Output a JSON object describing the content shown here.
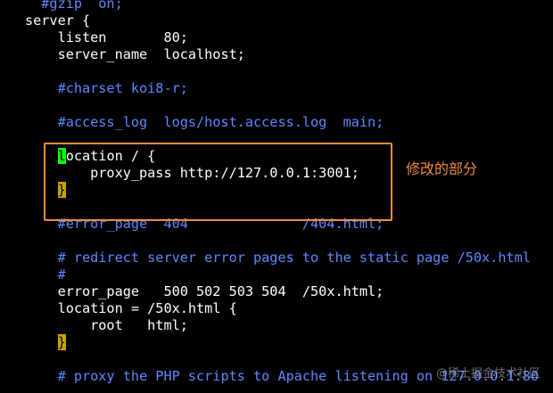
{
  "editor": {
    "lines": [
      {
        "text": "  #gzip  on;",
        "kind": "comment"
      },
      {
        "text": "server {",
        "kind": "code"
      },
      {
        "text": "    listen       80;",
        "kind": "code"
      },
      {
        "text": "    server_name  localhost;",
        "kind": "code"
      },
      {
        "text": "",
        "kind": "code"
      },
      {
        "text": "    #charset koi8-r;",
        "kind": "comment"
      },
      {
        "text": "",
        "kind": "code"
      },
      {
        "text": "    #access_log  logs/host.access.log  main;",
        "kind": "comment"
      },
      {
        "text": "",
        "kind": "code"
      },
      {
        "text": "    location / {",
        "kind": "code",
        "cursor_at": 4
      },
      {
        "text": "        proxy_pass http://127.0.0.1:3001;",
        "kind": "code"
      },
      {
        "text": "    }",
        "kind": "code",
        "brace_at": 4
      },
      {
        "text": "",
        "kind": "code"
      },
      {
        "text": "    #error_page  404              /404.html;",
        "kind": "comment"
      },
      {
        "text": "",
        "kind": "code"
      },
      {
        "text": "    # redirect server error pages to the static page /50x.html",
        "kind": "comment"
      },
      {
        "text": "    #",
        "kind": "comment"
      },
      {
        "text": "    error_page   500 502 503 504  /50x.html;",
        "kind": "code"
      },
      {
        "text": "    location = /50x.html {",
        "kind": "code"
      },
      {
        "text": "        root   html;",
        "kind": "code"
      },
      {
        "text": "    }",
        "kind": "code",
        "brace_at": 4
      },
      {
        "text": "",
        "kind": "code"
      },
      {
        "text": "    # proxy the PHP scripts to Apache listening on 127.0.0.1:80",
        "kind": "comment"
      }
    ]
  },
  "annotation": {
    "label": "修改的部分"
  },
  "watermark": {
    "text": "@稀土掘金技术社区"
  },
  "colors": {
    "background": "#000000",
    "code": "#ffffff",
    "comment": "#5f87ff",
    "cursor": "#00ff00",
    "brace_highlight": "#c8a400",
    "annotation": "#f08a3a"
  }
}
